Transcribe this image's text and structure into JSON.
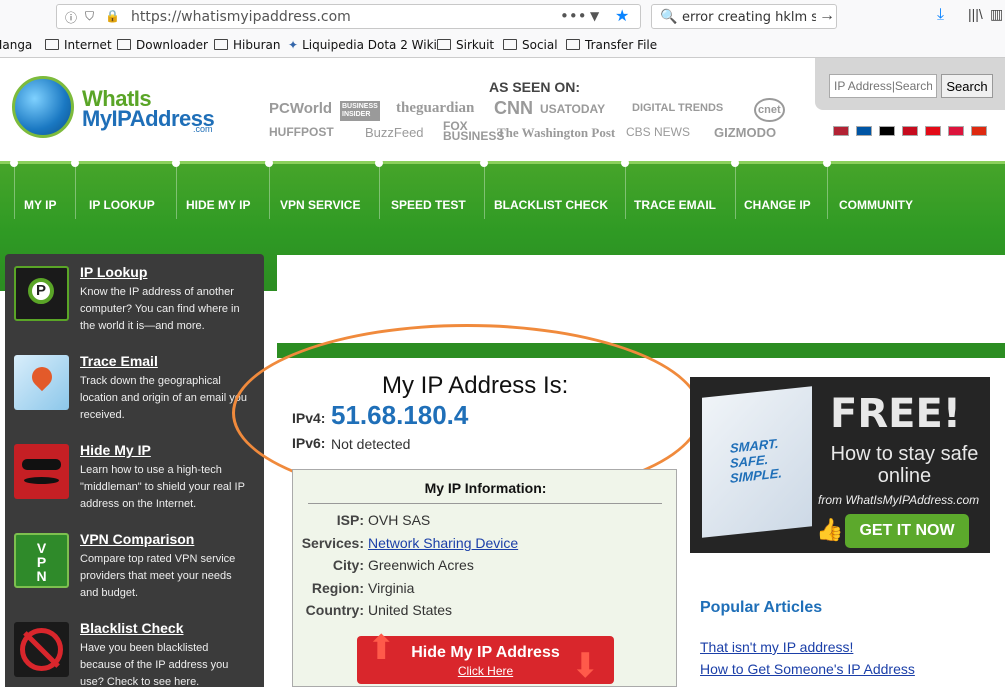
{
  "browser": {
    "url": "https://whatismyipaddress.com",
    "search_text": "error creating hklm s",
    "bookmarks": [
      "Manga",
      "Internet",
      "Downloader",
      "Hiburan",
      "Liquipedia Dota 2 Wiki",
      "Sirkuit",
      "Social",
      "Transfer File"
    ]
  },
  "header": {
    "logo_line1": "WhatIs",
    "logo_line2": "MyIPAddress",
    "logo_suffix": ".com",
    "as_seen_on": "AS SEEN ON:",
    "media_row1": [
      "PCWorld",
      "BUSINESS INSIDER",
      "theguardian",
      "CNN",
      "USATODAY",
      "DIGITAL TRENDS",
      "cnet"
    ],
    "media_row2": [
      "HUFFPOST",
      "BuzzFeed",
      "FOX BUSINESS",
      "The Washington Post",
      "CBS NEWS",
      "GIZMODO"
    ],
    "search_placeholder": "IP Address|Search",
    "search_button": "Search",
    "flags": [
      "#b22234",
      "#0055a4",
      "#000000",
      "#c60b1e",
      "#e30a17",
      "#dc143c",
      "#de2910"
    ]
  },
  "nav": [
    "MY IP",
    "IP LOOKUP",
    "HIDE MY IP",
    "VPN SERVICE",
    "SPEED TEST",
    "BLACKLIST CHECK",
    "TRACE EMAIL",
    "CHANGE IP",
    "COMMUNITY"
  ],
  "sidebar": [
    {
      "title": "IP Lookup",
      "desc": "Know the IP address of another computer? You can find where in the world it is—and more."
    },
    {
      "title": "Trace Email",
      "desc": "Track down the geographical location and origin of an email you received."
    },
    {
      "title": "Hide My IP",
      "desc": "Learn how to use a high-tech \"middleman\" to shield your real IP address on the Internet."
    },
    {
      "title": "VPN Comparison",
      "desc": "Compare top rated VPN service providers that meet your needs and budget."
    },
    {
      "title": "Blacklist Check",
      "desc": "Have you been blacklisted because of the IP address you use? Check to see here."
    }
  ],
  "ip": {
    "heading": "My IP Address Is:",
    "ipv4_label": "IPv4:",
    "ipv4": "51.68.180.4",
    "ipv6_label": "IPv6:",
    "ipv6": "Not detected"
  },
  "info": {
    "title": "My IP Information:",
    "rows": [
      {
        "key": "ISP:",
        "value": "OVH SAS"
      },
      {
        "key": "Services:",
        "value": "Network Sharing Device"
      },
      {
        "key": "City:",
        "value": "Greenwich Acres"
      },
      {
        "key": "Region:",
        "value": "Virginia"
      },
      {
        "key": "Country:",
        "value": "United States"
      }
    ],
    "button_title": "Hide My IP Address",
    "button_sub": "Click Here"
  },
  "promo": {
    "book_title": "SMART. SAFE. SIMPLE.",
    "free": "FREE!",
    "how": "How to stay safe online",
    "from": "from WhatIsMyIPAddress.com",
    "button": "GET IT NOW"
  },
  "popular": {
    "title": "Popular Articles",
    "links": [
      "That isn't my IP address!",
      "How to Get Someone's IP Address"
    ]
  }
}
